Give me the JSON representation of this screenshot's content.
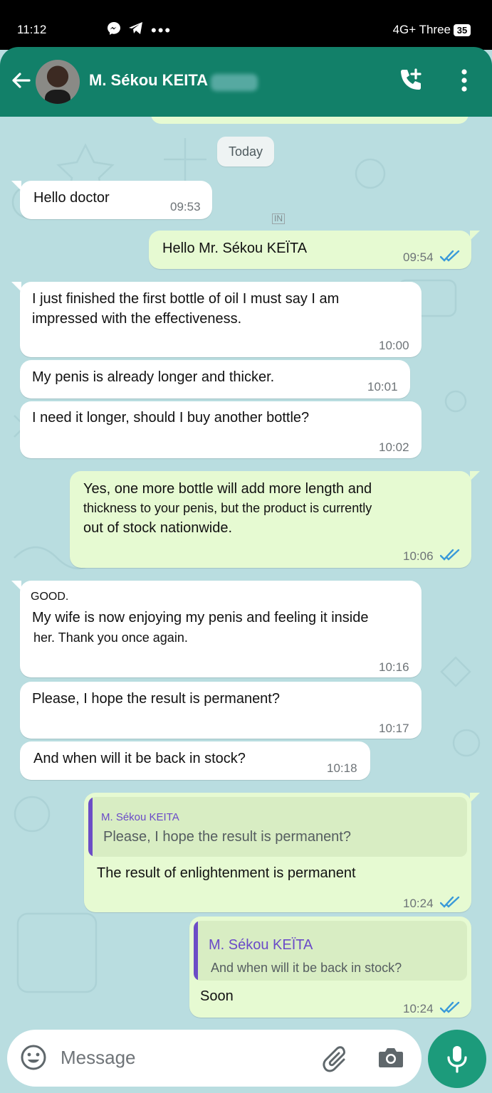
{
  "status_bar": {
    "time": "11:12",
    "network": "4G+ Three",
    "battery": "35"
  },
  "header": {
    "contact_name": "M. Sékou KEITA",
    "colors": {
      "header_bg": "#128069",
      "accent": "#1c9b7b"
    }
  },
  "chat": {
    "date_label": "Today",
    "in_tag": "IN",
    "messages": [
      {
        "dir": "in",
        "text": "Hello doctor",
        "time": "09:53"
      },
      {
        "dir": "out",
        "text": "Hello Mr. Sékou KEÏTA",
        "time": "09:54"
      },
      {
        "dir": "in",
        "text_lines": [
          "I just finished the first bottle of oil I must say I am",
          "impressed with the effectiveness."
        ],
        "time": "10:00"
      },
      {
        "dir": "in",
        "text": "My penis is already longer and thicker.",
        "time": "10:01"
      },
      {
        "dir": "in",
        "text": "I need it longer, should I buy another bottle?",
        "time": "10:02"
      },
      {
        "dir": "out",
        "text_lines": [
          "Yes, one more bottle will add more length and",
          "thickness to your penis, but the product is currently",
          "out of stock nationwide."
        ],
        "time": "10:06"
      },
      {
        "dir": "in",
        "text_lines": [
          "GOOD.",
          "My wife is now enjoying my penis and feeling it inside",
          "her. Thank you once again."
        ],
        "time": "10:16"
      },
      {
        "dir": "in",
        "text": "Please, I hope the result is permanent?",
        "time": "10:17"
      },
      {
        "dir": "in",
        "text": "And when will it be back in stock?",
        "time": "10:18"
      },
      {
        "dir": "out",
        "quote_name": "M. Sékou KEITA",
        "quote_text": "Please, I hope the result is permanent?",
        "text": "The result of enlightenment is permanent",
        "time": "10:24"
      },
      {
        "dir": "out",
        "quote_name": "M.  Sékou KEÏTA",
        "quote_text": "And when will it be back in stock?",
        "text": "Soon",
        "time": "10:24"
      }
    ]
  },
  "composer": {
    "placeholder": "Message"
  },
  "icons": [
    "back-arrow-icon",
    "add-call-icon",
    "more-vert-icon",
    "double-check-icon",
    "emoji-icon",
    "attach-icon",
    "camera-icon",
    "mic-icon",
    "messenger-icon",
    "telegram-icon"
  ]
}
